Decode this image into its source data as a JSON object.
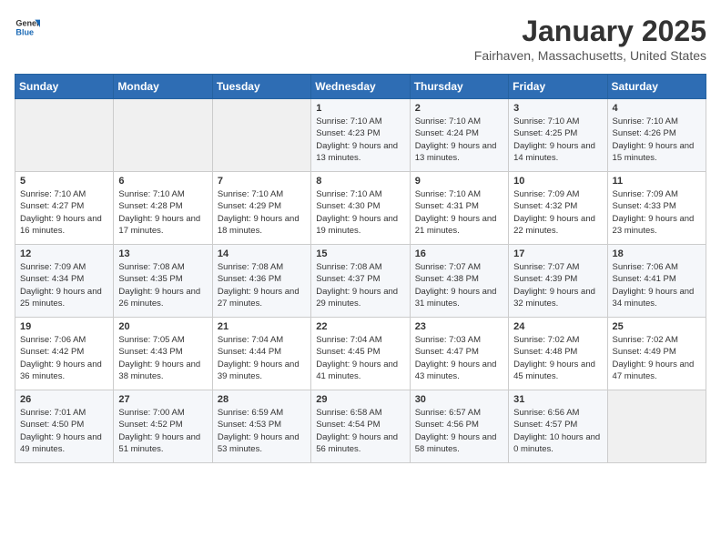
{
  "header": {
    "logo_general": "General",
    "logo_blue": "Blue",
    "title": "January 2025",
    "location": "Fairhaven, Massachusetts, United States"
  },
  "days_of_week": [
    "Sunday",
    "Monday",
    "Tuesday",
    "Wednesday",
    "Thursday",
    "Friday",
    "Saturday"
  ],
  "weeks": [
    [
      {
        "day": "",
        "empty": true
      },
      {
        "day": "",
        "empty": true
      },
      {
        "day": "",
        "empty": true
      },
      {
        "day": "1",
        "sunrise": "7:10 AM",
        "sunset": "4:23 PM",
        "daylight": "9 hours and 13 minutes."
      },
      {
        "day": "2",
        "sunrise": "7:10 AM",
        "sunset": "4:24 PM",
        "daylight": "9 hours and 13 minutes."
      },
      {
        "day": "3",
        "sunrise": "7:10 AM",
        "sunset": "4:25 PM",
        "daylight": "9 hours and 14 minutes."
      },
      {
        "day": "4",
        "sunrise": "7:10 AM",
        "sunset": "4:26 PM",
        "daylight": "9 hours and 15 minutes."
      }
    ],
    [
      {
        "day": "5",
        "sunrise": "7:10 AM",
        "sunset": "4:27 PM",
        "daylight": "9 hours and 16 minutes."
      },
      {
        "day": "6",
        "sunrise": "7:10 AM",
        "sunset": "4:28 PM",
        "daylight": "9 hours and 17 minutes."
      },
      {
        "day": "7",
        "sunrise": "7:10 AM",
        "sunset": "4:29 PM",
        "daylight": "9 hours and 18 minutes."
      },
      {
        "day": "8",
        "sunrise": "7:10 AM",
        "sunset": "4:30 PM",
        "daylight": "9 hours and 19 minutes."
      },
      {
        "day": "9",
        "sunrise": "7:10 AM",
        "sunset": "4:31 PM",
        "daylight": "9 hours and 21 minutes."
      },
      {
        "day": "10",
        "sunrise": "7:09 AM",
        "sunset": "4:32 PM",
        "daylight": "9 hours and 22 minutes."
      },
      {
        "day": "11",
        "sunrise": "7:09 AM",
        "sunset": "4:33 PM",
        "daylight": "9 hours and 23 minutes."
      }
    ],
    [
      {
        "day": "12",
        "sunrise": "7:09 AM",
        "sunset": "4:34 PM",
        "daylight": "9 hours and 25 minutes."
      },
      {
        "day": "13",
        "sunrise": "7:08 AM",
        "sunset": "4:35 PM",
        "daylight": "9 hours and 26 minutes."
      },
      {
        "day": "14",
        "sunrise": "7:08 AM",
        "sunset": "4:36 PM",
        "daylight": "9 hours and 27 minutes."
      },
      {
        "day": "15",
        "sunrise": "7:08 AM",
        "sunset": "4:37 PM",
        "daylight": "9 hours and 29 minutes."
      },
      {
        "day": "16",
        "sunrise": "7:07 AM",
        "sunset": "4:38 PM",
        "daylight": "9 hours and 31 minutes."
      },
      {
        "day": "17",
        "sunrise": "7:07 AM",
        "sunset": "4:39 PM",
        "daylight": "9 hours and 32 minutes."
      },
      {
        "day": "18",
        "sunrise": "7:06 AM",
        "sunset": "4:41 PM",
        "daylight": "9 hours and 34 minutes."
      }
    ],
    [
      {
        "day": "19",
        "sunrise": "7:06 AM",
        "sunset": "4:42 PM",
        "daylight": "9 hours and 36 minutes."
      },
      {
        "day": "20",
        "sunrise": "7:05 AM",
        "sunset": "4:43 PM",
        "daylight": "9 hours and 38 minutes."
      },
      {
        "day": "21",
        "sunrise": "7:04 AM",
        "sunset": "4:44 PM",
        "daylight": "9 hours and 39 minutes."
      },
      {
        "day": "22",
        "sunrise": "7:04 AM",
        "sunset": "4:45 PM",
        "daylight": "9 hours and 41 minutes."
      },
      {
        "day": "23",
        "sunrise": "7:03 AM",
        "sunset": "4:47 PM",
        "daylight": "9 hours and 43 minutes."
      },
      {
        "day": "24",
        "sunrise": "7:02 AM",
        "sunset": "4:48 PM",
        "daylight": "9 hours and 45 minutes."
      },
      {
        "day": "25",
        "sunrise": "7:02 AM",
        "sunset": "4:49 PM",
        "daylight": "9 hours and 47 minutes."
      }
    ],
    [
      {
        "day": "26",
        "sunrise": "7:01 AM",
        "sunset": "4:50 PM",
        "daylight": "9 hours and 49 minutes."
      },
      {
        "day": "27",
        "sunrise": "7:00 AM",
        "sunset": "4:52 PM",
        "daylight": "9 hours and 51 minutes."
      },
      {
        "day": "28",
        "sunrise": "6:59 AM",
        "sunset": "4:53 PM",
        "daylight": "9 hours and 53 minutes."
      },
      {
        "day": "29",
        "sunrise": "6:58 AM",
        "sunset": "4:54 PM",
        "daylight": "9 hours and 56 minutes."
      },
      {
        "day": "30",
        "sunrise": "6:57 AM",
        "sunset": "4:56 PM",
        "daylight": "9 hours and 58 minutes."
      },
      {
        "day": "31",
        "sunrise": "6:56 AM",
        "sunset": "4:57 PM",
        "daylight": "10 hours and 0 minutes."
      },
      {
        "day": "",
        "empty": true
      }
    ]
  ]
}
